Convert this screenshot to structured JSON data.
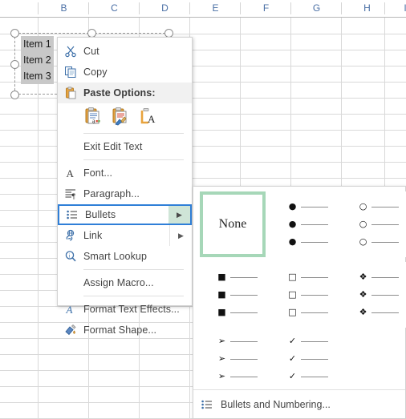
{
  "spreadsheet": {
    "columns": [
      "B",
      "C",
      "D",
      "E",
      "F",
      "G",
      "H",
      "I"
    ],
    "shape_text_lines": [
      "Item 1",
      "Item 2",
      "Item 3"
    ]
  },
  "context_menu": {
    "items": [
      {
        "id": "cut",
        "label": "Cut",
        "icon": "scissors-icon",
        "accel_index": 2
      },
      {
        "id": "copy",
        "label": "Copy",
        "icon": "copy-icon",
        "accel_index": 0
      },
      {
        "id": "paste-options",
        "label": "Paste Options:",
        "icon": "clipboard-icon",
        "header": true
      },
      {
        "id": "exit-edit-text",
        "label": "Exit Edit Text",
        "icon": "",
        "accel_index": 12
      },
      {
        "id": "font",
        "label": "Font...",
        "icon": "font-a-icon",
        "accel_index": 0
      },
      {
        "id": "paragraph",
        "label": "Paragraph...",
        "icon": "paragraph-icon",
        "accel_index": 0
      },
      {
        "id": "bullets",
        "label": "Bullets",
        "icon": "bullets-icon",
        "accel_index": 0,
        "submenu": true,
        "highlighted": true
      },
      {
        "id": "link",
        "label": "Link",
        "icon": "link-icon",
        "accel_index": 1,
        "submenu": true
      },
      {
        "id": "smart-lookup",
        "label": "Smart Lookup",
        "icon": "magnifier-icon",
        "accel_index": 6
      },
      {
        "id": "assign-macro",
        "label": "Assign Macro...",
        "icon": "",
        "accel_index": 7
      },
      {
        "id": "format-text-effects",
        "label": "Format Text Effects...",
        "icon": "text-effects-icon",
        "accel_index": 16
      },
      {
        "id": "format-shape",
        "label": "Format Shape...",
        "icon": "format-shape-icon",
        "accel_index": 1
      }
    ],
    "paste_options": [
      {
        "id": "paste-keep-source-formatting",
        "icon": "paste-a-icon"
      },
      {
        "id": "paste-formatting",
        "icon": "paste-brush-icon"
      },
      {
        "id": "paste-text-only",
        "icon": "paste-text-icon"
      }
    ],
    "submenu_arrow": "▶"
  },
  "bullets_submenu": {
    "none_label": "None",
    "gallery": [
      {
        "id": "bullet-none",
        "kind": "none",
        "glyph": "",
        "selected": true,
        "row": 0,
        "col": 0
      },
      {
        "id": "bullet-filled-round",
        "kind": "glyph",
        "glyph": "●",
        "selected": false,
        "row": 0,
        "col": 1
      },
      {
        "id": "bullet-hollow-round",
        "kind": "glyph",
        "glyph": "○",
        "selected": false,
        "row": 0,
        "col": 2
      },
      {
        "id": "bullet-filled-square",
        "kind": "glyph",
        "glyph": "■",
        "selected": false,
        "row": 1,
        "col": 0
      },
      {
        "id": "bullet-hollow-square",
        "kind": "glyph",
        "glyph": "□",
        "selected": false,
        "row": 1,
        "col": 1
      },
      {
        "id": "bullet-diamond",
        "kind": "glyph",
        "glyph": "❖",
        "selected": false,
        "row": 1,
        "col": 2
      },
      {
        "id": "bullet-arrow",
        "kind": "glyph",
        "glyph": "➢",
        "selected": false,
        "row": 2,
        "col": 0
      },
      {
        "id": "bullet-checkmark",
        "kind": "glyph",
        "glyph": "✓",
        "selected": false,
        "row": 2,
        "col": 1
      }
    ],
    "footer": {
      "id": "bullets-and-numbering",
      "label": "Bullets and Numbering...",
      "icon": "bullets-icon",
      "accel_index": 12
    }
  },
  "colors": {
    "menu_bg": "#ffffff",
    "menu_border": "#d3d3d3",
    "header_bg": "#f1f1f1",
    "highlight_border": "#2f7fd8",
    "submenu_arrow_bg": "#cfe5d7",
    "gallery_selection": "#a6d7b8",
    "grid_line": "#d9d9d9",
    "column_header_text": "#4a6fa5",
    "text_selection": "#c8c8c8",
    "menu_text": "#444444"
  }
}
